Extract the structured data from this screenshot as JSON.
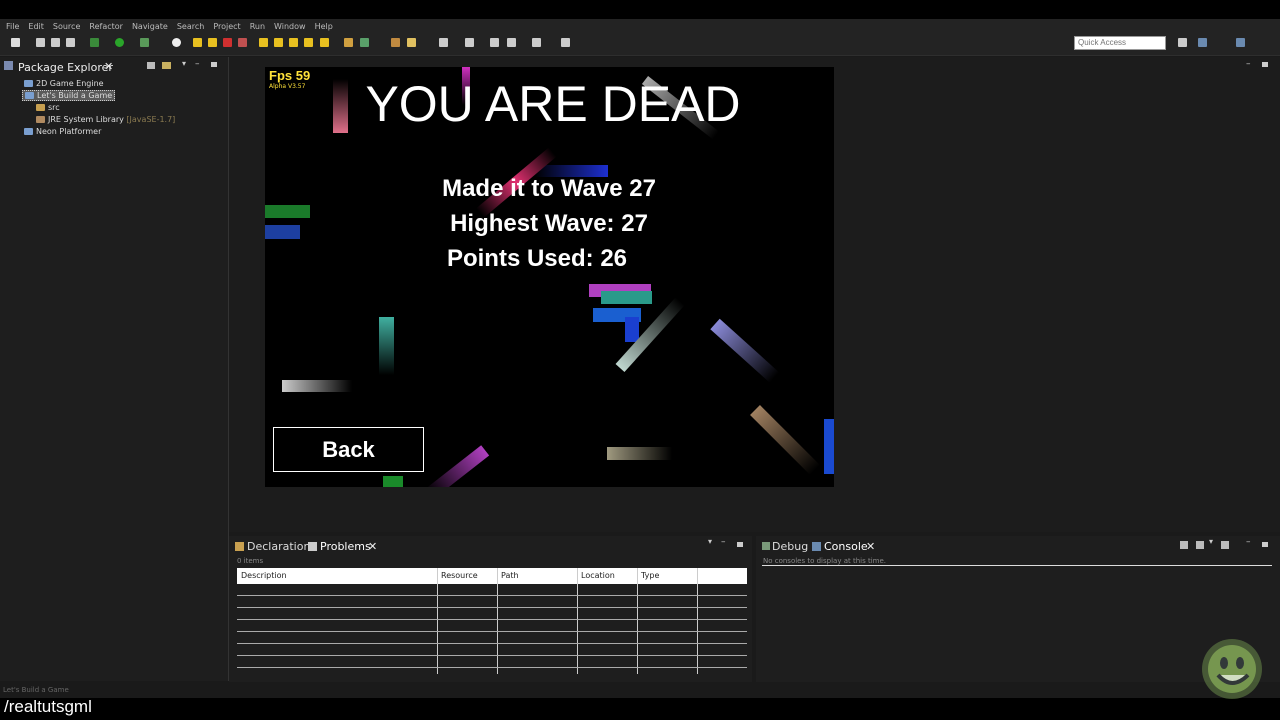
{
  "menu": [
    "File",
    "Edit",
    "Source",
    "Refactor",
    "Navigate",
    "Search",
    "Project",
    "Run",
    "Window",
    "Help"
  ],
  "quick_access": {
    "placeholder": "Quick Access"
  },
  "package_explorer": {
    "title": "Package Explorer",
    "items": [
      {
        "label": "2D Game Engine"
      },
      {
        "label": "Let's Build a Game"
      },
      {
        "label": "src"
      },
      {
        "label": "JRE System Library",
        "suffix": "[JavaSE-1.7]"
      },
      {
        "label": "Neon Platformer"
      }
    ]
  },
  "game": {
    "fps": "Fps 59",
    "version": "Alpha V3.57",
    "title": "YOU ARE DEAD",
    "wave": "Made it to Wave 27",
    "highest": "Highest Wave: 27",
    "points": "Points Used: 26",
    "back": "Back"
  },
  "problems_panel": {
    "tab_declaration": "Declaration",
    "tab_problems": "Problems",
    "count": "0 items",
    "columns": [
      "Description",
      "Resource",
      "Path",
      "Location",
      "Type"
    ]
  },
  "console_panel": {
    "tab_debug": "Debug",
    "tab_console": "Console",
    "message": "No consoles to display at this time."
  },
  "status": {
    "text": "Let's Build a Game"
  },
  "overlay": {
    "handle": "/realtutsgml"
  },
  "colors": {
    "accent_fps": "#ffe23a",
    "selection": "#5a5a5a"
  }
}
